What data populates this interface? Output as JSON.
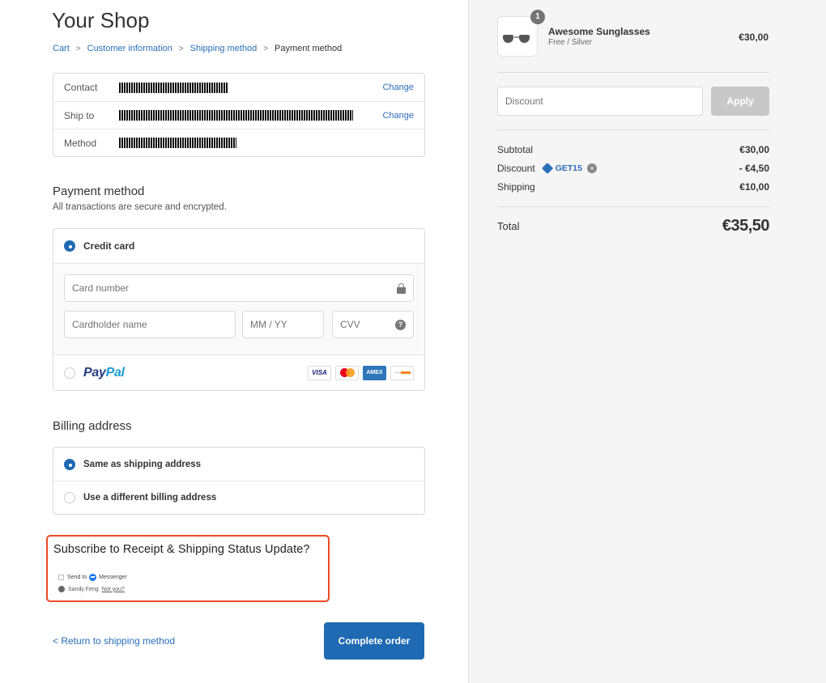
{
  "shop": {
    "title": "Your Shop"
  },
  "breadcrumb": {
    "cart": "Cart",
    "customer": "Customer information",
    "shipping": "Shipping method",
    "current": "Payment method",
    "separator": ">"
  },
  "review": {
    "contact_label": "Contact",
    "ship_label": "Ship to",
    "method_label": "Method",
    "change_label": "Change"
  },
  "payment": {
    "title": "Payment method",
    "subtitle": "All transactions are secure and encrypted.",
    "credit_card_label": "Credit card",
    "card_number_placeholder": "Card number",
    "cardholder_placeholder": "Cardholder name",
    "expiry_placeholder": "MM / YY",
    "cvv_placeholder": "CVV",
    "paypal_pay": "Pay",
    "paypal_pal": "Pal",
    "logos": {
      "visa": "VISA",
      "amex": "AMEX"
    }
  },
  "billing": {
    "title": "Billing address",
    "same_label": "Same as shipping address",
    "different_label": "Use a different billing address"
  },
  "subscribe": {
    "title": "Subscribe to Receipt & Shipping Status Update?",
    "send_to": "Send to",
    "messenger": "Messenger",
    "user_name": "Sandy Feng",
    "not_you": "Not you?"
  },
  "footer": {
    "return_label": "< Return to shipping method",
    "complete_label": "Complete order"
  },
  "summary": {
    "product_name": "Awesome Sunglasses",
    "product_variant": "Free / Silver",
    "product_price": "€30,00",
    "quantity": "1",
    "discount_placeholder": "Discount",
    "apply_label": "Apply",
    "subtotal_label": "Subtotal",
    "subtotal_value": "€30,00",
    "discount_label": "Discount",
    "discount_code": "GET15",
    "discount_value": "- €4,50",
    "shipping_label": "Shipping",
    "shipping_value": "€10,00",
    "total_label": "Total",
    "total_value": "€35,50"
  },
  "colors": {
    "accent": "#1f6ab3",
    "link": "#2a6ebb",
    "highlight": "#ec4a24",
    "sidebar_bg": "#f5f5f5"
  }
}
